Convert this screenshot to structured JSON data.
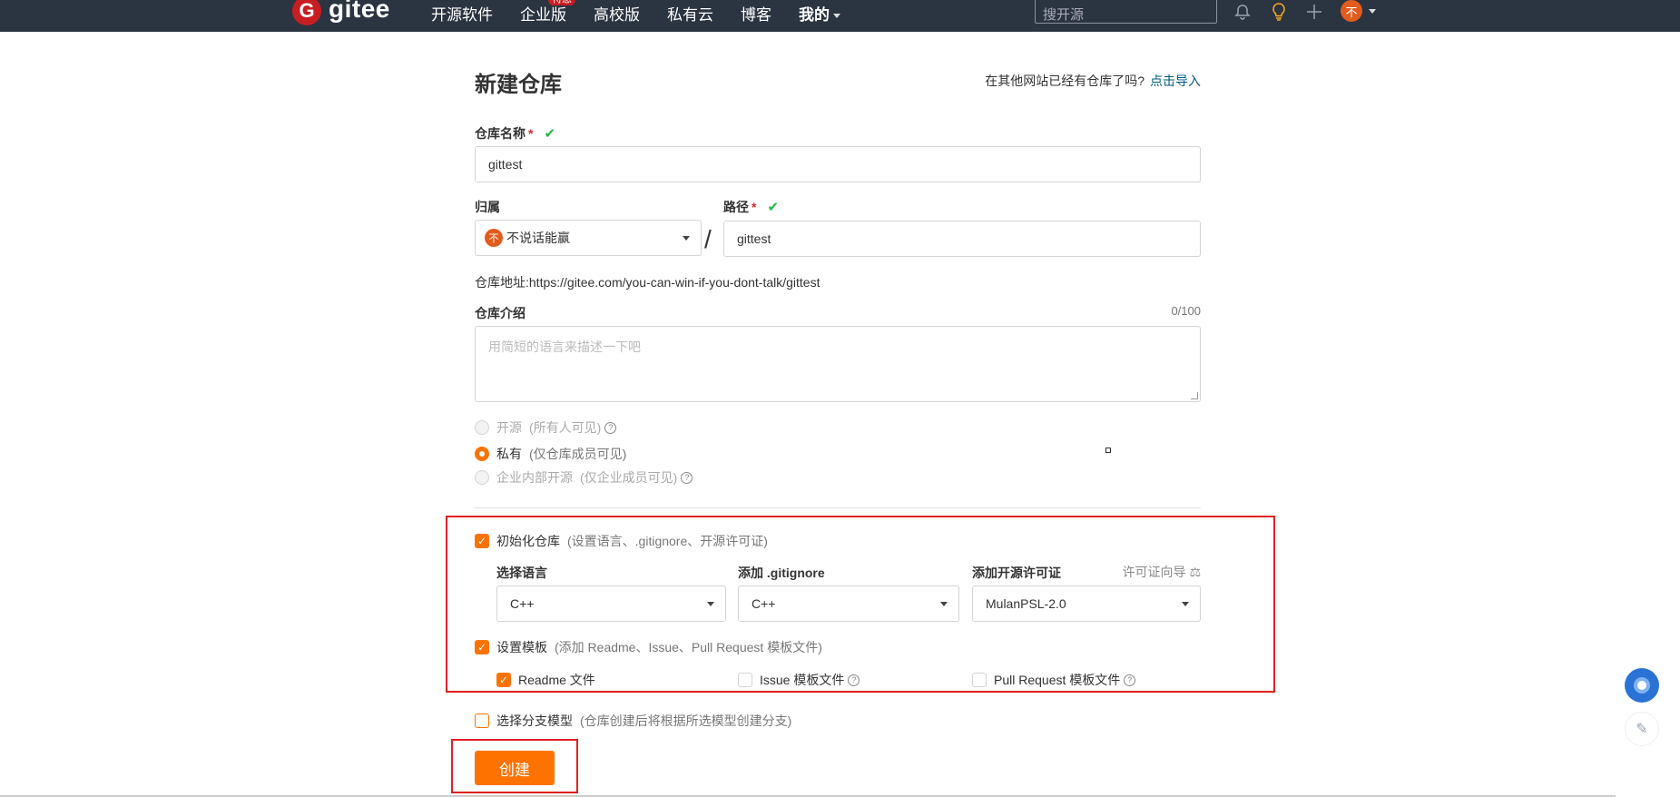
{
  "nav": {
    "logo_letter": "G",
    "logo_text": "gitee",
    "items": [
      "开源软件",
      "企业版",
      "高校版",
      "私有云",
      "博客",
      "我的"
    ],
    "hot_badge": "特惠",
    "search_placeholder": "搜开源",
    "avatar_text": "不"
  },
  "form": {
    "title": "新建仓库",
    "import_hint": "在其他网站已经有仓库了吗?",
    "import_link": "点击导入",
    "repo_name_label": "仓库名称",
    "repo_name_value": "gittest",
    "owner_label": "归属",
    "owner_avatar": "不",
    "owner_value": "不说话能赢",
    "slash": "/",
    "path_label": "路径",
    "path_value": "gittest",
    "repo_url_label": "仓库地址:",
    "repo_url": "https://gitee.com/you-can-win-if-you-dont-talk/gittest",
    "desc_label": "仓库介绍",
    "desc_counter": "0/100",
    "desc_placeholder": "用简短的语言来描述一下吧",
    "visibility": [
      {
        "label": "开源",
        "hint": "(所有人可见)",
        "selected": false,
        "disabled": true,
        "help": true
      },
      {
        "label": "私有",
        "hint": "(仅仓库成员可见)",
        "selected": true,
        "disabled": false,
        "help": false
      },
      {
        "label": "企业内部开源",
        "hint": "(仅企业成员可见)",
        "selected": false,
        "disabled": true,
        "help": true
      }
    ]
  },
  "init": {
    "checkbox_label": "初始化仓库",
    "checkbox_hint": "(设置语言、.gitignore、开源许可证)",
    "checked": true,
    "language_label": "选择语言",
    "language_value": "C++",
    "gitignore_label": "添加 .gitignore",
    "gitignore_value": "C++",
    "license_label": "添加开源许可证",
    "license_value": "MulanPSL-2.0",
    "license_guide": "许可证向导",
    "template_label": "设置模板",
    "template_hint": "(添加 Readme、Issue、Pull Request 模板文件)",
    "template_checked": true,
    "readme_label": "Readme 文件",
    "readme_checked": true,
    "issue_label": "Issue 模板文件",
    "issue_checked": false,
    "pr_label": "Pull Request 模板文件",
    "pr_checked": false
  },
  "branch": {
    "label": "选择分支模型",
    "hint": "(仓库创建后将根据所选模型创建分支)",
    "checked": false
  },
  "create_button": "创建",
  "colors": {
    "topbar": "#2b3441",
    "accent": "#fe7300",
    "highlight_box": "#e02020",
    "brand": "#c71d23",
    "link": "#005980"
  }
}
